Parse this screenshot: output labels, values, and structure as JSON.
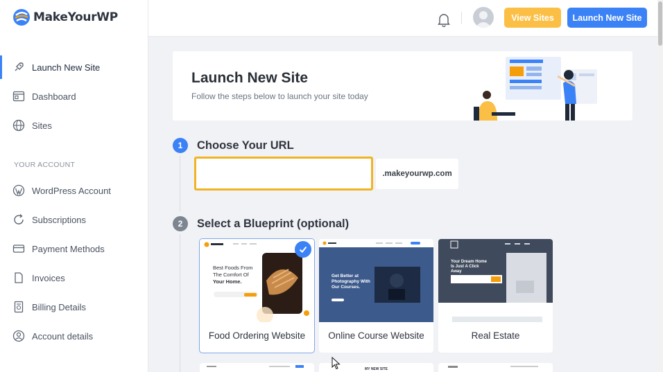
{
  "app": {
    "brand": "MakeYourWP",
    "brand_colors": {
      "blue": "#3b82f6",
      "orange": "#f59e0b",
      "accent_yellow": "#fbbf45"
    }
  },
  "sidebar": {
    "items": [
      {
        "label": "Launch New Site",
        "icon": "rocket-icon",
        "active": true
      },
      {
        "label": "Dashboard",
        "icon": "dashboard-icon"
      },
      {
        "label": "Sites",
        "icon": "globe-icon"
      }
    ],
    "section_label": "YOUR ACCOUNT",
    "account_items": [
      {
        "label": "WordPress Account",
        "icon": "wordpress-icon"
      },
      {
        "label": "Subscriptions",
        "icon": "refresh-icon"
      },
      {
        "label": "Payment Methods",
        "icon": "credit-card-icon"
      },
      {
        "label": "Invoices",
        "icon": "document-icon"
      },
      {
        "label": "Billing Details",
        "icon": "receipt-icon"
      },
      {
        "label": "Account details",
        "icon": "user-circle-icon"
      }
    ]
  },
  "header": {
    "view_sites_label": "View Sites",
    "launch_label": "Launch New Site"
  },
  "hero": {
    "title": "Launch New Site",
    "subtitle": "Follow the steps below to launch your site today"
  },
  "steps": {
    "step1": {
      "number": "1",
      "title": "Choose Your URL",
      "input_value": "",
      "input_placeholder": "",
      "suffix": ".makeyourwp.com"
    },
    "step2": {
      "number": "2",
      "title": "Select a Blueprint (optional)"
    }
  },
  "blueprints": [
    {
      "label": "Food Ordering Website",
      "selected": true,
      "thumb_headline": "Best Foods From The Comfort Of Your Home."
    },
    {
      "label": "Online Course Website",
      "selected": false,
      "thumb_headline": "Get Better at Photography With Our Courses."
    },
    {
      "label": "Real Estate",
      "selected": false,
      "thumb_headline": "Your Dream Home Is Just A Click Away"
    }
  ],
  "peek": {
    "title2": "MY NEW SITE"
  }
}
